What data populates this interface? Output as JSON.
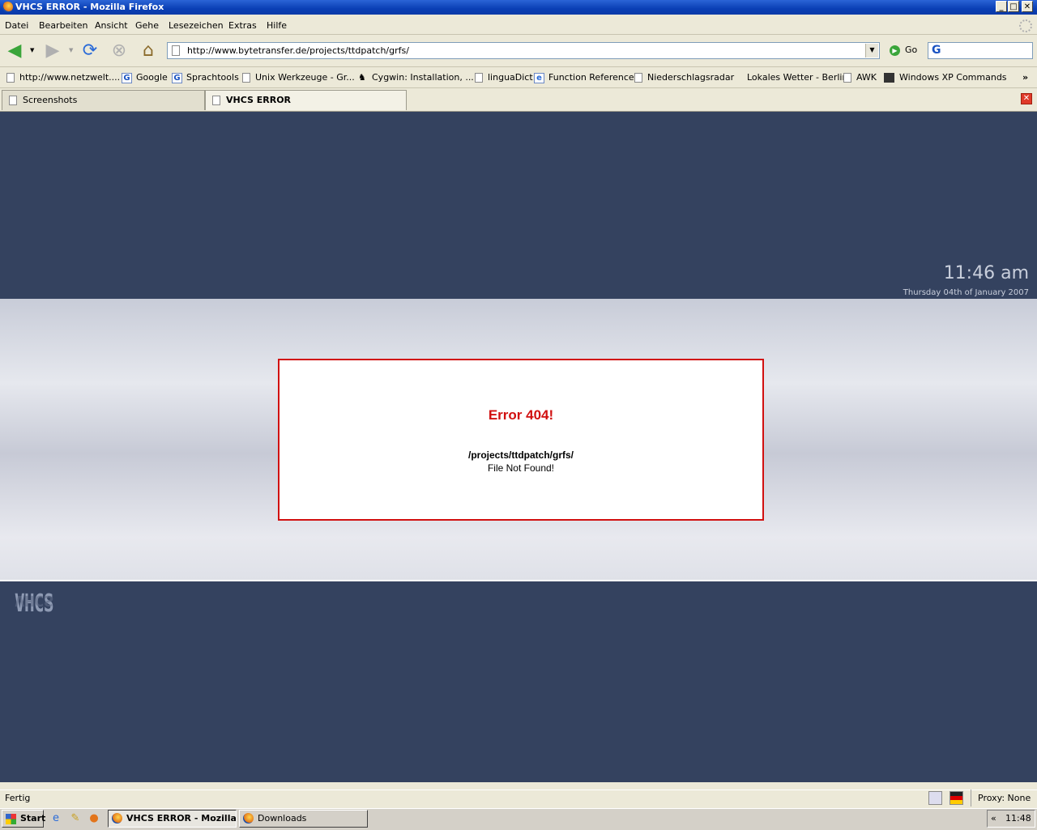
{
  "window": {
    "title": "VHCS ERROR - Mozilla Firefox"
  },
  "menu": {
    "items": [
      "Datei",
      "Bearbeiten",
      "Ansicht",
      "Gehe",
      "Lesezeichen",
      "Extras",
      "Hilfe"
    ]
  },
  "navbar": {
    "url": "http://www.bytetransfer.de/projects/ttdpatch/grfs/",
    "go_label": "Go",
    "search_value": ""
  },
  "bookmarks": [
    "http://www.netzwelt....",
    "Google",
    "Sprachtools",
    "Unix Werkzeuge - Gr...",
    "Cygwin: Installation, ...",
    "linguaDict",
    "Function Reference",
    "Niederschlagsradar",
    "Lokales Wetter - Berlin",
    "AWK",
    "Windows XP Commands"
  ],
  "bookmarks_overflow": "»",
  "tabs": [
    {
      "label": "Screenshots",
      "active": false
    },
    {
      "label": "VHCS ERROR",
      "active": true
    }
  ],
  "page": {
    "clock": "11:46 am",
    "date": "Thursday 04th of January 2007",
    "error_title": "Error 404!",
    "error_path": "/projects/ttdpatch/grfs/",
    "error_message": "File Not Found!",
    "logo_text": "VHCS"
  },
  "status": {
    "text": "Fertig",
    "proxy": "Proxy: None"
  },
  "taskbar": {
    "start_label": "Start",
    "tasks": [
      {
        "label": "VHCS ERROR - Mozilla ...",
        "active": true
      },
      {
        "label": "Downloads",
        "active": false
      }
    ],
    "tray_chevron": "«",
    "time": "11:48"
  },
  "colors": {
    "page_background": "#34425f",
    "error_red": "#d11010"
  }
}
